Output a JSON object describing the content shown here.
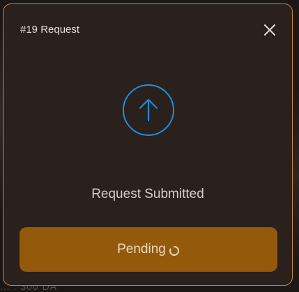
{
  "background": {
    "partial_text": "... : 300 DA"
  },
  "modal": {
    "title": "#19 Request",
    "status_text": "Request Submitted",
    "button_label": "Pending",
    "close_icon": "close-icon",
    "status_icon": "arrow-up-circle-icon",
    "spinner_icon": "spinner-icon"
  },
  "colors": {
    "accent": "#1e8fe0",
    "button": "#95590c",
    "border": "#c9893a",
    "panel": "#2a211d"
  }
}
